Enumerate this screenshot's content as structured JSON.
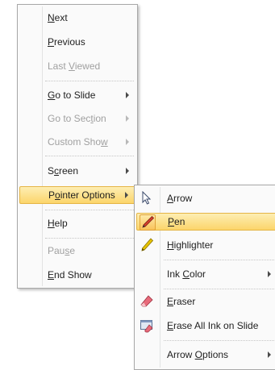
{
  "main_menu": {
    "items": [
      {
        "pre": "",
        "key": "N",
        "post": "ext",
        "enabled": true,
        "submenu": false
      },
      {
        "pre": "",
        "key": "P",
        "post": "revious",
        "enabled": true,
        "submenu": false
      },
      {
        "pre": "Last ",
        "key": "V",
        "post": "iewed",
        "enabled": false,
        "submenu": false
      },
      {
        "pre": "",
        "key": "G",
        "post": "o to Slide",
        "enabled": true,
        "submenu": true
      },
      {
        "pre": "Go to Sec",
        "key": "t",
        "post": "ion",
        "enabled": false,
        "submenu": true
      },
      {
        "pre": "Custom Sho",
        "key": "w",
        "post": "",
        "enabled": false,
        "submenu": true
      },
      {
        "pre": "S",
        "key": "c",
        "post": "reen",
        "enabled": true,
        "submenu": true
      },
      {
        "pre": "P",
        "key": "o",
        "post": "inter Options",
        "enabled": true,
        "submenu": true,
        "highlighted": true
      },
      {
        "pre": "",
        "key": "H",
        "post": "elp",
        "enabled": true,
        "submenu": false
      },
      {
        "pre": "Pau",
        "key": "s",
        "post": "e",
        "enabled": false,
        "submenu": false
      },
      {
        "pre": "",
        "key": "E",
        "post": "nd Show",
        "enabled": true,
        "submenu": false
      }
    ]
  },
  "sub_menu": {
    "items": [
      {
        "pre": "",
        "key": "A",
        "post": "rrow",
        "icon": "arrow-cursor-icon",
        "submenu": false
      },
      {
        "pre": "",
        "key": "P",
        "post": "en",
        "icon": "pen-icon",
        "submenu": false,
        "highlighted": true
      },
      {
        "pre": "",
        "key": "H",
        "post": "ighlighter",
        "icon": "highlighter-icon",
        "submenu": false
      },
      {
        "pre": "Ink ",
        "key": "C",
        "post": "olor",
        "icon": "",
        "submenu": true
      },
      {
        "pre": "",
        "key": "E",
        "post": "raser",
        "icon": "eraser-icon",
        "submenu": false
      },
      {
        "pre": "",
        "key": "E",
        "post": "rase All Ink on Slide",
        "icon": "erase-all-ink-icon",
        "submenu": false
      },
      {
        "pre": "Arrow ",
        "key": "O",
        "post": "ptions",
        "icon": "",
        "submenu": true
      }
    ]
  },
  "colors": {
    "highlight_top": "#fdeeb3",
    "highlight_bottom": "#fcd56b",
    "disabled_text": "#a0a0a0"
  }
}
